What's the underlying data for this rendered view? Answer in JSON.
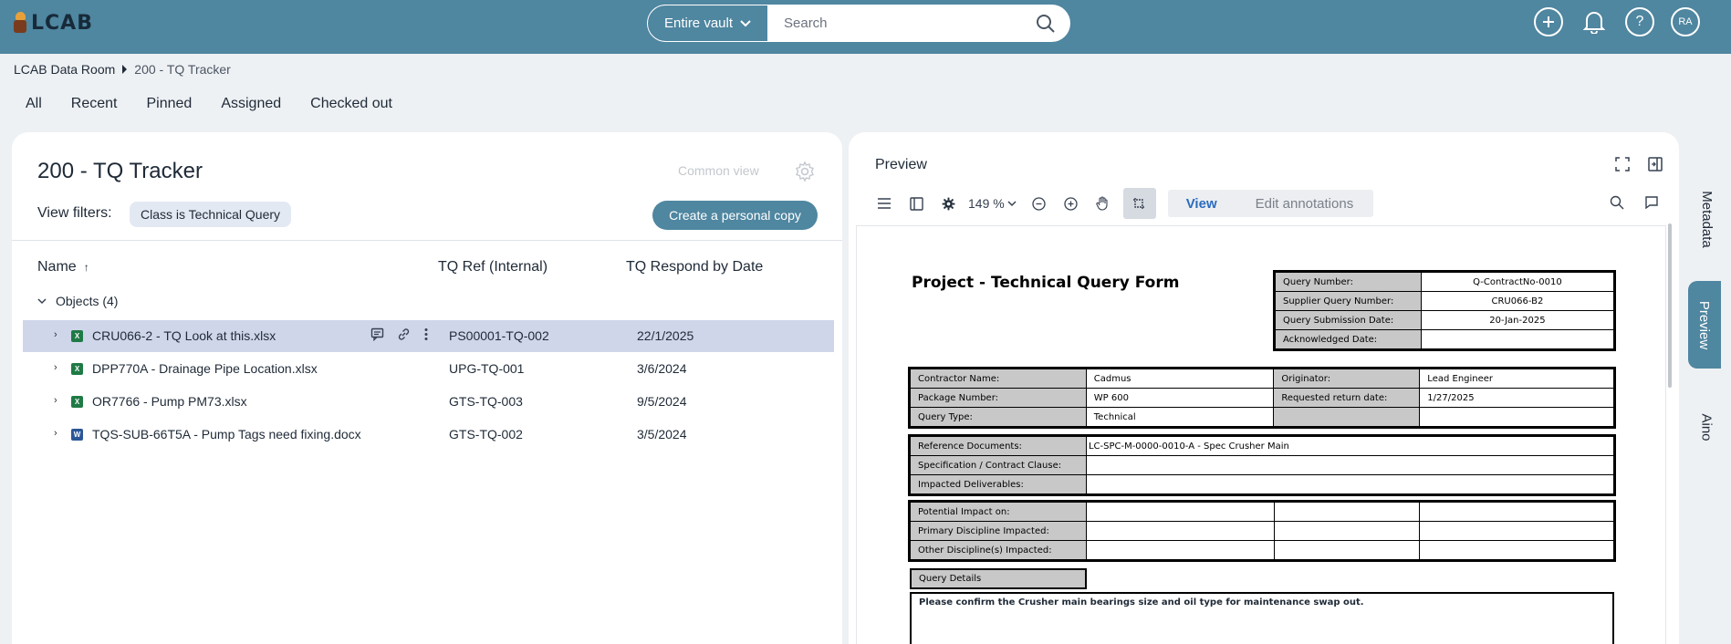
{
  "app": {
    "logo_text": "LCAB",
    "vault_select": "Entire vault",
    "search_placeholder": "Search",
    "avatar_initials": "RA"
  },
  "icons": {
    "add": "plus-circle-icon",
    "notifications": "bell-icon",
    "help": "question-circle-icon",
    "search": "search-icon"
  },
  "breadcrumb": {
    "root": "LCAB Data Room",
    "current": "200 - TQ Tracker"
  },
  "tabs": [
    "All",
    "Recent",
    "Pinned",
    "Assigned",
    "Checked out"
  ],
  "list": {
    "title": "200 - TQ Tracker",
    "common_view": "Common view",
    "view_filters_label": "View filters:",
    "filter_chip": "Class is Technical Query",
    "create_copy": "Create a personal copy",
    "columns": {
      "name": "Name",
      "ref": "TQ Ref (Internal)",
      "date": "TQ Respond by Date"
    },
    "group_label": "Objects (4)",
    "rows": [
      {
        "name": "CRU066-2 - TQ Look at this.xlsx",
        "ref": "PS00001-TQ-002",
        "date": "22/1/2025",
        "type": "xls",
        "icon_letter": "X"
      },
      {
        "name": "DPP770A - Drainage Pipe Location.xlsx",
        "ref": "UPG-TQ-001",
        "date": "3/6/2024",
        "type": "xls",
        "icon_letter": "X"
      },
      {
        "name": "OR7766 - Pump PM73.xlsx",
        "ref": "GTS-TQ-003",
        "date": "9/5/2024",
        "type": "xls",
        "icon_letter": "X"
      },
      {
        "name": "TQS-SUB-66T5A - Pump Tags need fixing.docx",
        "ref": "GTS-TQ-002",
        "date": "3/5/2024",
        "type": "doc",
        "icon_letter": "W"
      }
    ]
  },
  "preview": {
    "title": "Preview",
    "zoom": "149 %",
    "view_btn": "View",
    "edit_btn": "Edit annotations"
  },
  "form": {
    "title": "Project - Technical Query Form",
    "query_info": [
      {
        "label": "Query Number:",
        "value": "Q-ContractNo-0010"
      },
      {
        "label": "Supplier Query Number:",
        "value": "CRU066-B2"
      },
      {
        "label": "Query Submission Date:",
        "value": "20-Jan-2025"
      },
      {
        "label": "Acknowledged Date:",
        "value": ""
      }
    ],
    "contractor": [
      {
        "label": "Contractor Name:",
        "value": "Cadmus",
        "label2": "Originator:",
        "value2": "Lead Engineer"
      },
      {
        "label": "Package Number:",
        "value": "WP 600",
        "label2": "Requested return date:",
        "value2": "1/27/2025"
      },
      {
        "label": "Query Type:",
        "value": "Technical",
        "label2": "",
        "value2": ""
      }
    ],
    "references": [
      {
        "label": "Reference Documents:",
        "value": "LC-SPC-M-0000-0010-A - Spec Crusher Main"
      },
      {
        "label": "Specification / Contract Clause:",
        "value": ""
      },
      {
        "label": "Impacted Deliverables:",
        "value": ""
      }
    ],
    "impacts": [
      {
        "label": "Potential Impact on:"
      },
      {
        "label": "Primary Discipline Impacted:"
      },
      {
        "label": "Other Discipline(s) Impacted:"
      }
    ],
    "details_label": "Query Details",
    "details_text": "Please confirm the Crusher main bearings size and oil type for maintenance swap out."
  },
  "side_tabs": [
    "Metadata",
    "Preview",
    "Aino"
  ]
}
